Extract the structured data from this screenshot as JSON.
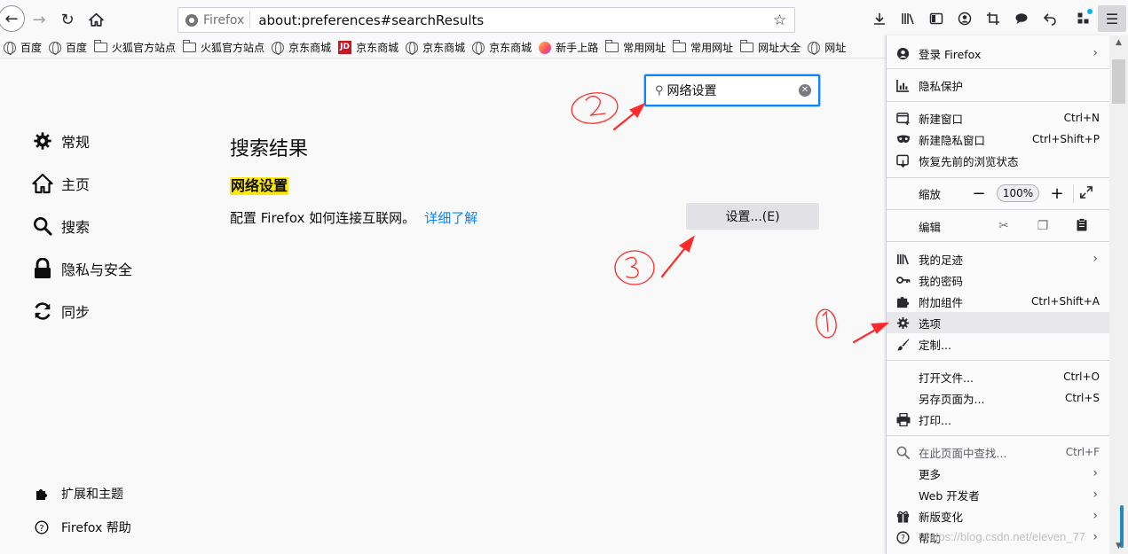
{
  "toolbar": {
    "identity_label": "Firefox",
    "url": "about:preferences#searchResults"
  },
  "bookmarks": [
    {
      "label": "百度",
      "icon": "globe-icon"
    },
    {
      "label": "百度",
      "icon": "globe-icon"
    },
    {
      "label": "火狐官方站点",
      "icon": "folder-icon"
    },
    {
      "label": "火狐官方站点",
      "icon": "folder-icon"
    },
    {
      "label": "京东商城",
      "icon": "globe-icon"
    },
    {
      "label": "京东商城",
      "icon": "jd-icon"
    },
    {
      "label": "京东商城",
      "icon": "globe-icon"
    },
    {
      "label": "京东商城",
      "icon": "globe-icon"
    },
    {
      "label": "新手上路",
      "icon": "firefox-icon"
    },
    {
      "label": "常用网址",
      "icon": "folder-icon"
    },
    {
      "label": "常用网址",
      "icon": "folder-icon"
    },
    {
      "label": "网址大全",
      "icon": "folder-icon"
    },
    {
      "label": "网址",
      "icon": "globe-icon"
    }
  ],
  "sidebar": {
    "items": [
      {
        "label": "常规",
        "icon": "gear-icon"
      },
      {
        "label": "主页",
        "icon": "home-icon"
      },
      {
        "label": "搜索",
        "icon": "search-icon"
      },
      {
        "label": "隐私与安全",
        "icon": "lock-icon"
      },
      {
        "label": "同步",
        "icon": "sync-icon"
      }
    ],
    "footer": [
      {
        "label": "扩展和主题",
        "icon": "puzzle-icon"
      },
      {
        "label": "Firefox 帮助",
        "icon": "help-icon"
      }
    ]
  },
  "search": {
    "value": "网络设置"
  },
  "results": {
    "title": "搜索结果",
    "section_heading": "网络设置",
    "description": "配置 Firefox 如何连接互联网。",
    "learn_more": "详细了解",
    "settings_button": "设置...(E)"
  },
  "menu": {
    "login": "登录 Firefox",
    "privacy": "隐私保护",
    "new_window": "新建窗口",
    "new_window_sc": "Ctrl+N",
    "new_private": "新建隐私窗口",
    "new_private_sc": "Ctrl+Shift+P",
    "restore": "恢复先前的浏览状态",
    "zoom_label": "缩放",
    "zoom_minus": "−",
    "zoom_value": "100%",
    "zoom_plus": "+",
    "edit_label": "编辑",
    "library": "我的足迹",
    "passwords": "我的密码",
    "addons": "附加组件",
    "addons_sc": "Ctrl+Shift+A",
    "options": "选项",
    "customize": "定制...",
    "open_file": "打开文件...",
    "open_file_sc": "Ctrl+O",
    "save_page": "另存页面为...",
    "save_page_sc": "Ctrl+S",
    "print": "打印...",
    "find": "在此页面中查找...",
    "find_sc": "Ctrl+F",
    "more": "更多",
    "web_dev": "Web 开发者",
    "whats_new": "新版变化",
    "help": "帮助"
  },
  "watermark": "https://blog.csdn.net/eleven_77",
  "colors": {
    "accent": "#0a84ff",
    "highlight": "#ffe900",
    "annotation": "#ff2a2a"
  }
}
